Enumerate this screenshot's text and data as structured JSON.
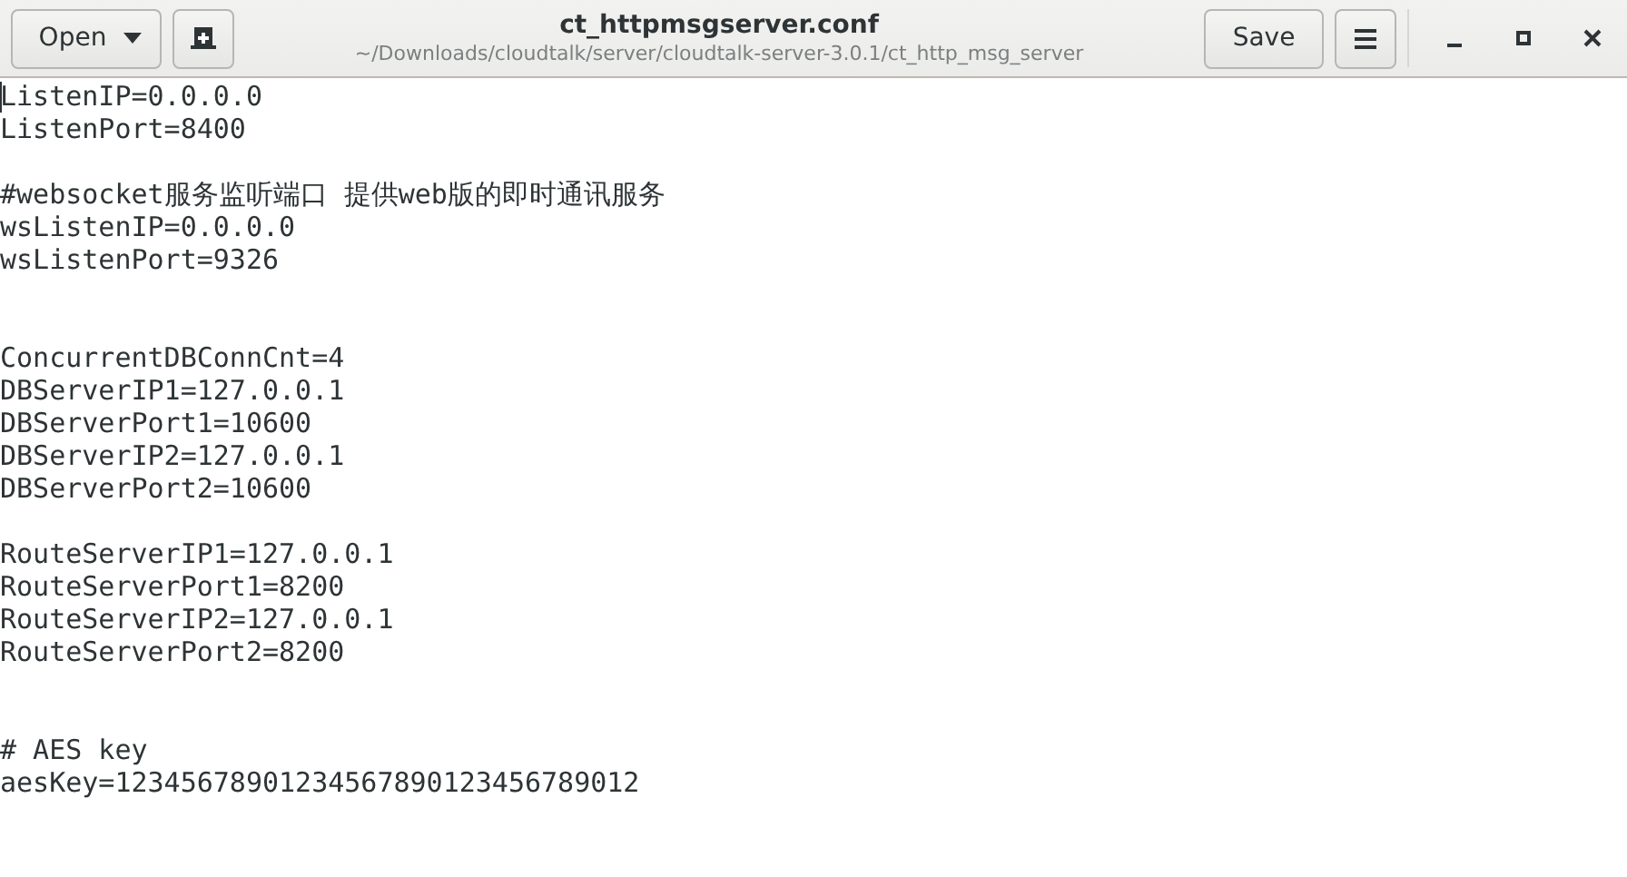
{
  "header_bar": {
    "open_button": {
      "label": "Open"
    },
    "title": "ct_httpmsgserver.conf",
    "subtitle": "~/Downloads/cloudtalk/server/cloudtalk-server-3.0.1/ct_http_msg_server",
    "save_button": {
      "label": "Save"
    }
  },
  "editor": {
    "lines": [
      {
        "kind": "code",
        "text": "ListenIP=0.0.0.0",
        "cursor": true
      },
      {
        "kind": "code",
        "text": "ListenPort=8400",
        "cursor": false
      },
      {
        "kind": "blank"
      },
      {
        "kind": "code",
        "text": "#websocket服务监听端口 提供web版的即时通讯服务",
        "cursor": false
      },
      {
        "kind": "code",
        "text": "wsListenIP=0.0.0.0",
        "cursor": false
      },
      {
        "kind": "code",
        "text": "wsListenPort=9326",
        "cursor": false
      },
      {
        "kind": "blank"
      },
      {
        "kind": "blank"
      },
      {
        "kind": "code",
        "text": "ConcurrentDBConnCnt=4",
        "cursor": false
      },
      {
        "kind": "code",
        "text": "DBServerIP1=127.0.0.1",
        "cursor": false
      },
      {
        "kind": "code",
        "text": "DBServerPort1=10600",
        "cursor": false
      },
      {
        "kind": "code",
        "text": "DBServerIP2=127.0.0.1",
        "cursor": false
      },
      {
        "kind": "code",
        "text": "DBServerPort2=10600",
        "cursor": false
      },
      {
        "kind": "blank"
      },
      {
        "kind": "code",
        "text": "RouteServerIP1=127.0.0.1",
        "cursor": false
      },
      {
        "kind": "code",
        "text": "RouteServerPort1=8200",
        "cursor": false
      },
      {
        "kind": "code",
        "text": "RouteServerIP2=127.0.0.1",
        "cursor": false
      },
      {
        "kind": "code",
        "text": "RouteServerPort2=8200",
        "cursor": false
      },
      {
        "kind": "blank"
      },
      {
        "kind": "blank"
      },
      {
        "kind": "code",
        "text": "# AES key",
        "cursor": false
      },
      {
        "kind": "code",
        "text": "aesKey=12345678901234567890123456789012",
        "cursor": false
      }
    ]
  }
}
